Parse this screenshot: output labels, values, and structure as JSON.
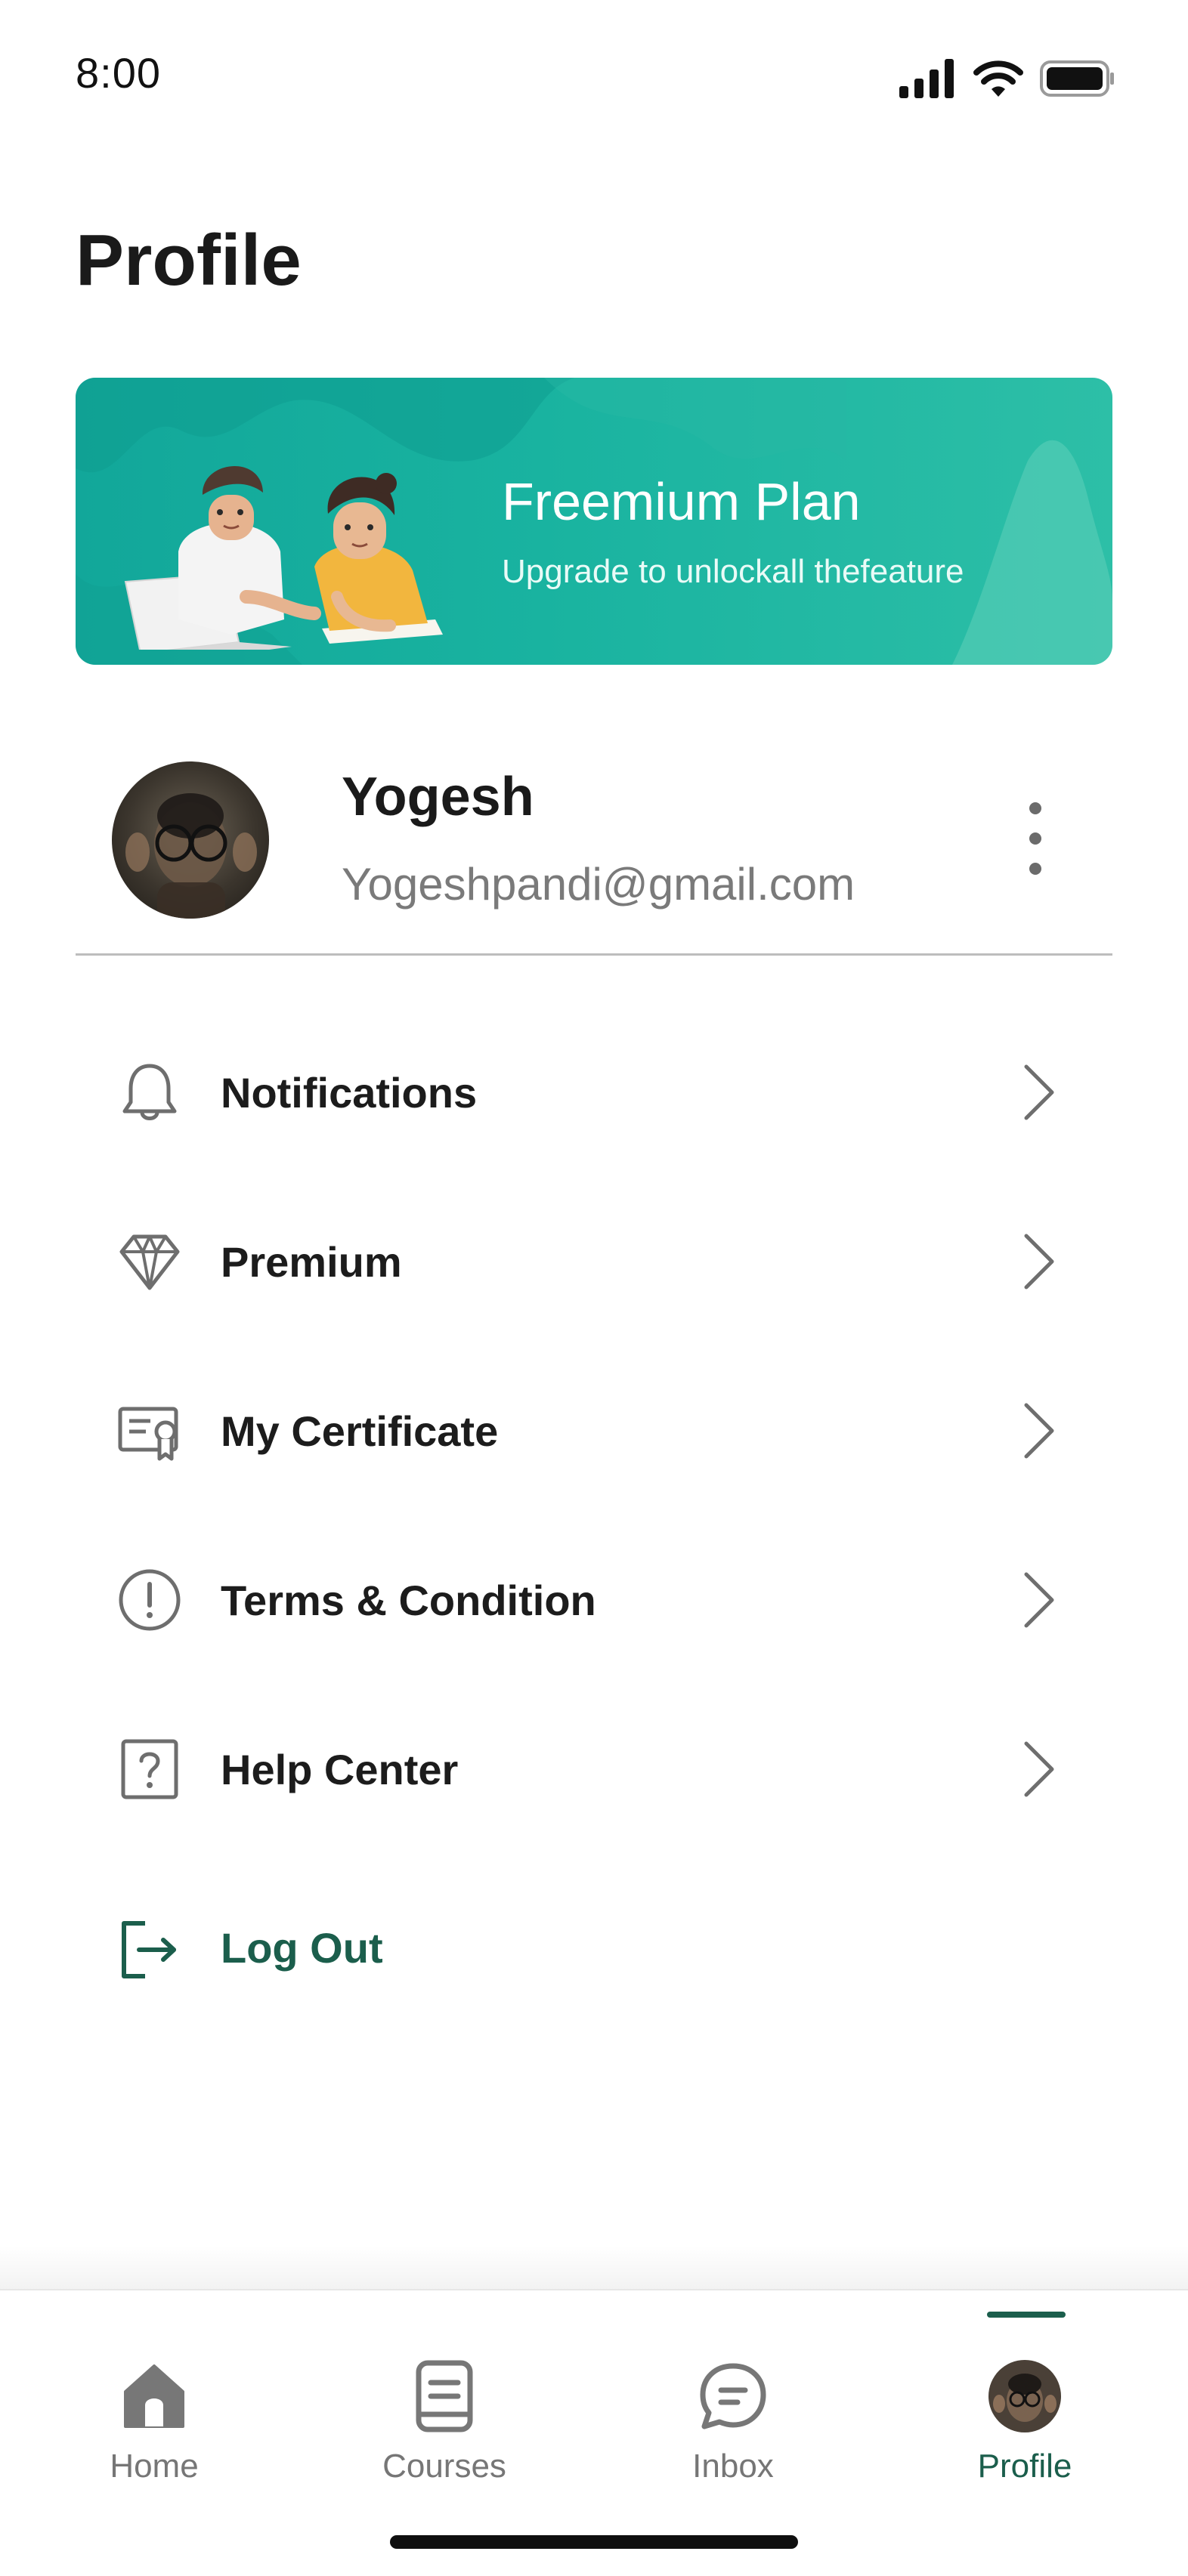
{
  "status_bar": {
    "time": "8:00",
    "icons": [
      "signal-icon",
      "wifi-icon",
      "battery-icon"
    ]
  },
  "page": {
    "title": "Profile"
  },
  "banner": {
    "title": "Freemium Plan",
    "subtitle": "Upgrade to unlockall thefeature",
    "color": "#19b3a0"
  },
  "user": {
    "name": "Yogesh",
    "email": "Yogeshpandi@gmail.com"
  },
  "menu": {
    "items": [
      {
        "label": "Notifications",
        "icon": "bell-icon"
      },
      {
        "label": "Premium",
        "icon": "diamond-icon"
      },
      {
        "label": "My Certificate",
        "icon": "certificate-icon"
      },
      {
        "label": "Terms & Condition",
        "icon": "info-icon"
      },
      {
        "label": "Help Center",
        "icon": "help-icon"
      }
    ],
    "logout_label": "Log Out"
  },
  "bottom_nav": {
    "items": [
      {
        "label": "Home",
        "icon": "home-icon"
      },
      {
        "label": "Courses",
        "icon": "book-icon"
      },
      {
        "label": "Inbox",
        "icon": "chat-icon"
      },
      {
        "label": "Profile",
        "icon": "avatar-icon"
      }
    ],
    "active": "Profile",
    "accent": "#1b5e4c"
  }
}
